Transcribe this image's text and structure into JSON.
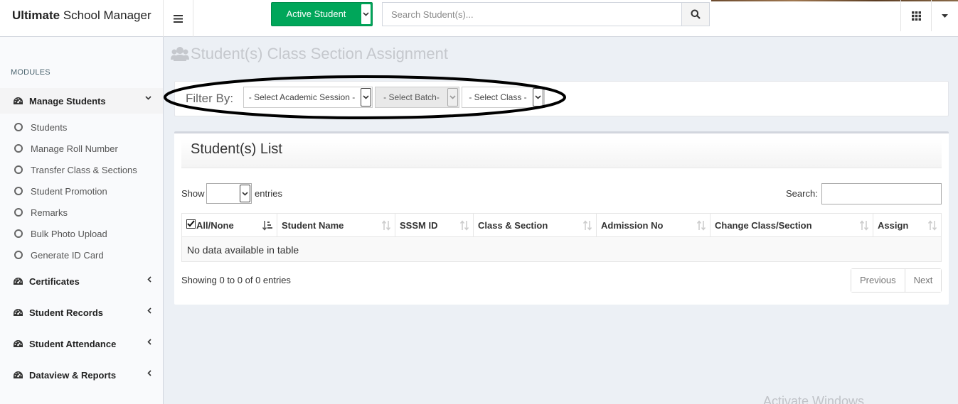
{
  "header": {
    "brand_bold": "Ultimate",
    "brand_rest": "School Manager",
    "active_student_label": "Active Student",
    "search_placeholder": "Search Student(s)..."
  },
  "sidebar": {
    "section_header": "MODULES",
    "manage_students": {
      "label": "Manage Students",
      "items": [
        {
          "label": "Students"
        },
        {
          "label": "Manage Roll Number"
        },
        {
          "label": "Transfer Class & Sections"
        },
        {
          "label": "Student Promotion"
        },
        {
          "label": "Remarks"
        },
        {
          "label": "Bulk Photo Upload"
        },
        {
          "label": "Generate ID Card"
        }
      ]
    },
    "groups": [
      {
        "label": "Certificates"
      },
      {
        "label": "Student Records"
      },
      {
        "label": "Student Attendance"
      },
      {
        "label": "Dataview & Reports"
      }
    ]
  },
  "page": {
    "title": "Student(s) Class Section Assignment"
  },
  "filter": {
    "label": "Filter By:",
    "session_select": "- Select Academic Session -",
    "batch_select": "- Select Batch-",
    "class_select": "- Select Class -"
  },
  "student_list": {
    "title": "Student(s) List",
    "show_label": "Show",
    "entries_label": "entries",
    "search_label": "Search:",
    "columns": [
      "All/None",
      "Student Name",
      "SSSM ID",
      "Class & Section",
      "Admission No",
      "Change Class/Section",
      "Assign"
    ],
    "empty_message": "No data available in table",
    "info": "Showing 0 to 0 of 0 entries",
    "previous_label": "Previous",
    "next_label": "Next"
  },
  "watermark": "Activate Windows",
  "colors": {
    "primary_green": "#00a65a",
    "sidebar_bg": "#f9fafc",
    "content_bg": "#ecf0f5"
  }
}
